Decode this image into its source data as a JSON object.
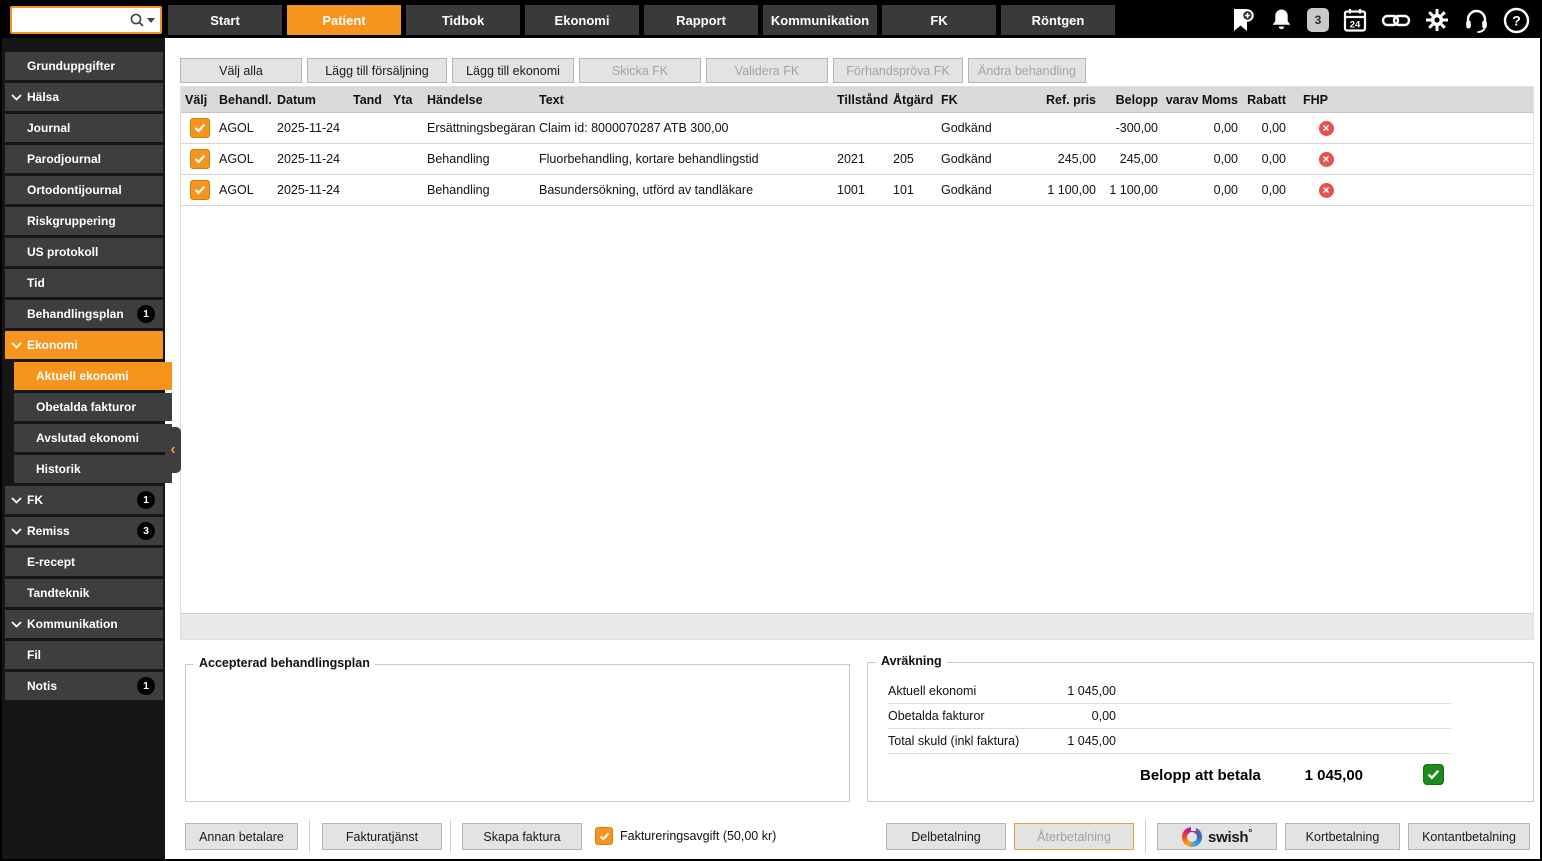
{
  "topbar": {
    "search_placeholder": "",
    "tabs": [
      {
        "label": "Start"
      },
      {
        "label": "Patient"
      },
      {
        "label": "Tidbok"
      },
      {
        "label": "Ekonomi"
      },
      {
        "label": "Rapport"
      },
      {
        "label": "Kommunikation"
      },
      {
        "label": "FK"
      },
      {
        "label": "Röntgen"
      }
    ],
    "active_tab": "Patient",
    "message_count": "3",
    "calendar_day": "24"
  },
  "sidebar": {
    "items": [
      {
        "label": "Grunduppgifter"
      },
      {
        "label": "Hälsa",
        "expandable": true
      },
      {
        "label": "Journal"
      },
      {
        "label": "Parodjournal"
      },
      {
        "label": "Ortodontijournal"
      },
      {
        "label": "Riskgruppering"
      },
      {
        "label": "US protokoll"
      },
      {
        "label": "Tid"
      },
      {
        "label": "Behandlingsplan",
        "badge": "1"
      },
      {
        "label": "Ekonomi",
        "expandable": true,
        "active": true
      },
      {
        "label": "Aktuell ekonomi",
        "sub": true,
        "selected": true
      },
      {
        "label": "Obetalda fakturor",
        "sub": true
      },
      {
        "label": "Avslutad ekonomi",
        "sub": true
      },
      {
        "label": "Historik",
        "sub": true
      },
      {
        "label": "FK",
        "expandable": true,
        "badge": "1"
      },
      {
        "label": "Remiss",
        "expandable": true,
        "badge": "3"
      },
      {
        "label": "E-recept"
      },
      {
        "label": "Tandteknik"
      },
      {
        "label": "Kommunikation",
        "expandable": true
      },
      {
        "label": "Fil"
      },
      {
        "label": "Notis",
        "badge": "1"
      }
    ]
  },
  "toolbar": {
    "buttons": [
      {
        "label": "Välj alla",
        "enabled": true
      },
      {
        "label": "Lägg till försäljning",
        "enabled": true
      },
      {
        "label": "Lägg till ekonomi",
        "enabled": true
      },
      {
        "label": "Skicka FK",
        "enabled": false
      },
      {
        "label": "Validera FK",
        "enabled": false
      },
      {
        "label": "Förhandspröva FK",
        "enabled": false
      },
      {
        "label": "Ändra behandling",
        "enabled": false
      }
    ]
  },
  "table": {
    "columns": [
      "Välj",
      "Behandl.",
      "Datum",
      "Tand",
      "Yta",
      "Händelse",
      "Text",
      "Tillstånd",
      "Åtgärd",
      "FK",
      "Ref. pris",
      "Belopp",
      "varav Moms",
      "Rabatt",
      "FHP"
    ],
    "rows": [
      {
        "checked": true,
        "behandl": "AGOL",
        "datum": "2025-11-24",
        "tand": "",
        "yta": "",
        "handelse": "Ersättningsbegäran",
        "text": "Claim id: 8000070287 ATB 300,00",
        "tillstand": "",
        "atgard": "",
        "fk": "Godkänd",
        "ref_pris": "",
        "belopp": "-300,00",
        "varav_moms": "0,00",
        "rabatt": "0,00"
      },
      {
        "checked": true,
        "behandl": "AGOL",
        "datum": "2025-11-24",
        "tand": "",
        "yta": "",
        "handelse": "Behandling",
        "text": "Fluorbehandling, kortare behandlingstid",
        "tillstand": "2021",
        "atgard": "205",
        "fk": "Godkänd",
        "ref_pris": "245,00",
        "belopp": "245,00",
        "varav_moms": "0,00",
        "rabatt": "0,00"
      },
      {
        "checked": true,
        "behandl": "AGOL",
        "datum": "2025-11-24",
        "tand": "",
        "yta": "",
        "handelse": "Behandling",
        "text": "Basundersökning, utförd av tandläkare",
        "tillstand": "1001",
        "atgard": "101",
        "fk": "Godkänd",
        "ref_pris": "1 100,00",
        "belopp": "1 100,00",
        "varav_moms": "0,00",
        "rabatt": "0,00"
      }
    ]
  },
  "plan_box": {
    "title": "Accepterad behandlingsplan"
  },
  "settlement": {
    "title": "Avräkning",
    "rows": [
      {
        "label": "Aktuell ekonomi",
        "value": "1 045,00"
      },
      {
        "label": "Obetalda fakturor",
        "value": "0,00"
      },
      {
        "label": "Total skuld (inkl faktura)",
        "value": "1 045,00"
      }
    ],
    "total_label": "Belopp att betala",
    "total_value": "1 045,00"
  },
  "footer": {
    "annan_betalare": "Annan betalare",
    "fakturatjanst": "Fakturatjänst",
    "skapa_faktura": "Skapa faktura",
    "invoice_fee_label": "Faktureringsavgift (50,00 kr)",
    "delbetalning": "Delbetalning",
    "aterbetalning": "Återbetalning",
    "swish": "swish",
    "kortbetalning": "Kortbetalning",
    "kontantbetalning": "Kontantbetalning"
  },
  "colors": {
    "accent_orange": "#f7941d",
    "success_green": "#1d8a1d",
    "danger_red": "#e2544d"
  }
}
